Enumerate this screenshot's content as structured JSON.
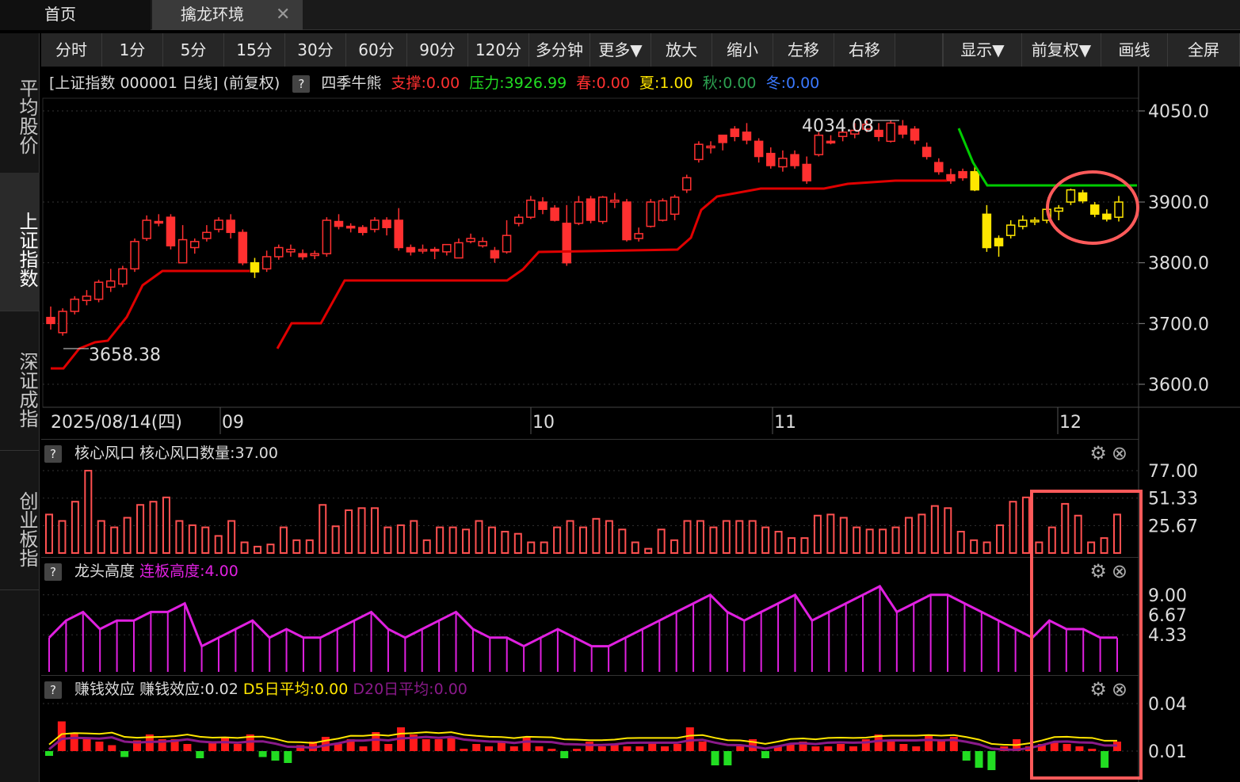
{
  "tabs": {
    "home": "首页",
    "active": "擒龙环境",
    "close_glyph": "✕"
  },
  "leftnav": [
    {
      "label": "平均股价",
      "active": false
    },
    {
      "label": "上证指数",
      "active": true
    },
    {
      "label": "深证成指",
      "active": false
    },
    {
      "label": "创业板指",
      "active": false
    }
  ],
  "toolbar": {
    "periods": [
      "分时",
      "1分",
      "5分",
      "15分",
      "30分",
      "60分",
      "90分",
      "120分",
      "多分钟",
      "更多▼"
    ],
    "actions": [
      "放大",
      "缩小",
      "左移",
      "右移"
    ],
    "right": [
      "显示▼",
      "前复权▼",
      "画线",
      "全屏"
    ]
  },
  "main_header": {
    "title": "[上证指数 000001 日线]",
    "adjust": "(前复权)",
    "help": "?",
    "indicator": "四季牛熊",
    "support": "支撑:0.00",
    "pressure": "压力:3926.99",
    "spring": "春:0.00",
    "summer": "夏:1.00",
    "autumn": "秋:0.00",
    "winter": "冬:0.00"
  },
  "colors": {
    "up": "#ff3030",
    "down": "#ff3030",
    "yellow": "#ffe600",
    "support_line": "#e00000",
    "pressure_line": "#00cc00",
    "magenta": "#e020e0",
    "green_bar": "#22dd22",
    "highlight": "#ff5a5a",
    "spring_color": "#ff3030",
    "summer_color": "#ffe600",
    "autumn_color": "#2ca050",
    "winter_color": "#3a78ff"
  },
  "price_axis": [
    "4050.0",
    "3900.0",
    "3800.0",
    "3700.0",
    "3600.0"
  ],
  "date_axis": {
    "first": "2025/08/14(四)",
    "months": [
      "09",
      "10",
      "11",
      "12"
    ]
  },
  "annotations": {
    "high": "4034.08",
    "low": "3658.38"
  },
  "panels": [
    {
      "name": "核心风口",
      "value": "核心风口数量:37.00",
      "axis": [
        "77.00",
        "51.33",
        "25.67"
      ]
    },
    {
      "name": "龙头高度",
      "value": "连板高度:4.00",
      "axis": [
        "9.00",
        "6.67",
        "4.33"
      ]
    },
    {
      "name": "赚钱效应",
      "value": "赚钱效应:0.02",
      "d5": "D5日平均:0.00",
      "d20": "D20日平均:0.00",
      "axis": [
        "0.04",
        "0.01"
      ]
    }
  ],
  "chart_data": {
    "type": "candlestick",
    "candles": [
      [
        3710,
        3700,
        3728,
        3690,
        "r"
      ],
      [
        3685,
        3720,
        3725,
        3680,
        "r"
      ],
      [
        3720,
        3740,
        3745,
        3715,
        "r"
      ],
      [
        3738,
        3745,
        3755,
        3730,
        "r"
      ],
      [
        3740,
        3768,
        3772,
        3735,
        "r"
      ],
      [
        3760,
        3770,
        3790,
        3752,
        "r"
      ],
      [
        3765,
        3790,
        3795,
        3760,
        "r"
      ],
      [
        3790,
        3835,
        3840,
        3785,
        "r"
      ],
      [
        3840,
        3870,
        3878,
        3836,
        "r"
      ],
      [
        3868,
        3868,
        3880,
        3860,
        "r"
      ],
      [
        3875,
        3828,
        3880,
        3822,
        "r"
      ],
      [
        3800,
        3838,
        3862,
        3800,
        "r"
      ],
      [
        3825,
        3835,
        3840,
        3815,
        "r"
      ],
      [
        3840,
        3850,
        3862,
        3835,
        "r"
      ],
      [
        3855,
        3870,
        3875,
        3850,
        "r"
      ],
      [
        3870,
        3850,
        3880,
        3840,
        "r"
      ],
      [
        3850,
        3800,
        3855,
        3796,
        "r"
      ],
      [
        3800,
        3785,
        3808,
        3775,
        "y"
      ],
      [
        3790,
        3810,
        3820,
        3785,
        "r"
      ],
      [
        3810,
        3825,
        3830,
        3805,
        "r"
      ],
      [
        3818,
        3822,
        3830,
        3810,
        "r"
      ],
      [
        3815,
        3810,
        3822,
        3805,
        "r"
      ],
      [
        3812,
        3815,
        3820,
        3806,
        "r"
      ],
      [
        3815,
        3870,
        3875,
        3810,
        "r"
      ],
      [
        3868,
        3860,
        3880,
        3855,
        "r"
      ],
      [
        3860,
        3858,
        3865,
        3850,
        "r"
      ],
      [
        3858,
        3850,
        3862,
        3845,
        "r"
      ],
      [
        3855,
        3870,
        3875,
        3850,
        "r"
      ],
      [
        3870,
        3858,
        3875,
        3845,
        "r"
      ],
      [
        3870,
        3825,
        3890,
        3820,
        "r"
      ],
      [
        3825,
        3818,
        3830,
        3812,
        "r"
      ],
      [
        3820,
        3822,
        3830,
        3815,
        "r"
      ],
      [
        3822,
        3820,
        3826,
        3806,
        "r"
      ],
      [
        3818,
        3830,
        3830,
        3812,
        "r"
      ],
      [
        3808,
        3833,
        3840,
        3808,
        "r"
      ],
      [
        3835,
        3840,
        3848,
        3832,
        "r"
      ],
      [
        3828,
        3835,
        3842,
        3825,
        "r"
      ],
      [
        3820,
        3808,
        3826,
        3800,
        "r"
      ],
      [
        3818,
        3845,
        3870,
        3815,
        "r"
      ],
      [
        3865,
        3875,
        3880,
        3860,
        "r"
      ],
      [
        3875,
        3903,
        3910,
        3872,
        "r"
      ],
      [
        3900,
        3888,
        3908,
        3880,
        "r"
      ],
      [
        3890,
        3870,
        3895,
        3868,
        "r"
      ],
      [
        3865,
        3800,
        3895,
        3795,
        "r"
      ],
      [
        3865,
        3900,
        3910,
        3862,
        "r"
      ],
      [
        3905,
        3870,
        3910,
        3865,
        "r"
      ],
      [
        3868,
        3908,
        3910,
        3864,
        "r"
      ],
      [
        3900,
        3903,
        3915,
        3890,
        "r"
      ],
      [
        3900,
        3838,
        3905,
        3835,
        "r"
      ],
      [
        3840,
        3848,
        3858,
        3835,
        "r"
      ],
      [
        3860,
        3900,
        3905,
        3858,
        "r"
      ],
      [
        3870,
        3902,
        3906,
        3868,
        "r"
      ],
      [
        3880,
        3908,
        3912,
        3870,
        "r"
      ],
      [
        3920,
        3940,
        3945,
        3915,
        "r"
      ],
      [
        3970,
        3995,
        4000,
        3965,
        "r"
      ],
      [
        3990,
        3992,
        4000,
        3980,
        "r"
      ],
      [
        4010,
        3998,
        4010,
        3985,
        "r"
      ],
      [
        4020,
        4008,
        4025,
        4000,
        "r"
      ],
      [
        4015,
        4002,
        4030,
        3995,
        "r"
      ],
      [
        4000,
        3975,
        4005,
        3965,
        "r"
      ],
      [
        3980,
        3960,
        3990,
        3955,
        "r"
      ],
      [
        3958,
        3972,
        3985,
        3950,
        "r"
      ],
      [
        3978,
        3960,
        3985,
        3955,
        "r"
      ],
      [
        3962,
        3935,
        3975,
        3930,
        "r"
      ],
      [
        3978,
        4010,
        4015,
        3975,
        "r"
      ],
      [
        4000,
        4000,
        4010,
        3995,
        "r"
      ],
      [
        4008,
        4015,
        4025,
        4000,
        "r"
      ],
      [
        4012,
        4018,
        4030,
        4005,
        "r"
      ],
      [
        4020,
        4028,
        4034,
        4015,
        "r"
      ],
      [
        4018,
        4008,
        4030,
        4000,
        "r"
      ],
      [
        4000,
        4030,
        4034,
        3998,
        "r"
      ],
      [
        4025,
        4012,
        4035,
        4005,
        "r"
      ],
      [
        4020,
        4002,
        4025,
        3995,
        "r"
      ],
      [
        3990,
        3975,
        3998,
        3970,
        "r"
      ],
      [
        3965,
        3950,
        3972,
        3945,
        "r"
      ],
      [
        3945,
        3935,
        3955,
        3930,
        "r"
      ],
      [
        3950,
        3940,
        3955,
        3935,
        "r"
      ],
      [
        3950,
        3920,
        3958,
        3918,
        "y"
      ],
      [
        3880,
        3825,
        3895,
        3818,
        "y"
      ],
      [
        3840,
        3828,
        3845,
        3810,
        "y"
      ],
      [
        3845,
        3862,
        3870,
        3840,
        "y"
      ],
      [
        3860,
        3870,
        3878,
        3855,
        "y"
      ],
      [
        3868,
        3870,
        3875,
        3862,
        "y"
      ],
      [
        3870,
        3888,
        3895,
        3865,
        "y"
      ],
      [
        3885,
        3890,
        3895,
        3870,
        "y"
      ],
      [
        3900,
        3920,
        3922,
        3895,
        "y"
      ],
      [
        3915,
        3902,
        3920,
        3898,
        "y"
      ],
      [
        3895,
        3880,
        3900,
        3875,
        "y"
      ],
      [
        3880,
        3872,
        3888,
        3868,
        "y"
      ],
      [
        3875,
        3900,
        3910,
        3868,
        "y"
      ]
    ],
    "panel1_values": [
      36,
      30,
      48,
      77,
      30,
      24,
      33,
      45,
      48,
      52,
      30,
      26,
      24,
      16,
      30,
      10,
      6,
      8,
      24,
      12,
      12,
      45,
      25,
      40,
      42,
      42,
      24,
      26,
      30,
      12,
      24,
      24,
      22,
      30,
      24,
      20,
      18,
      10,
      10,
      24,
      30,
      24,
      32,
      30,
      22,
      10,
      4,
      22,
      12,
      30,
      30,
      24,
      30,
      30,
      30,
      24,
      20,
      14,
      14,
      35,
      36,
      33,
      24,
      22,
      22,
      24,
      33,
      36,
      44,
      42,
      20,
      12,
      10,
      26,
      48,
      52,
      10,
      24,
      46,
      35,
      10,
      14,
      36
    ],
    "panel2_values": [
      4,
      6,
      7,
      5,
      6,
      6,
      7,
      7,
      8,
      3,
      4,
      5,
      6,
      4,
      5,
      4,
      4,
      5,
      6,
      7,
      5,
      4,
      5,
      6,
      7,
      5,
      4,
      4,
      3,
      4,
      5,
      4,
      3,
      3,
      4,
      5,
      6,
      7,
      8,
      9,
      7,
      6,
      7,
      8,
      9,
      6,
      7,
      8,
      9,
      10,
      7,
      8,
      9,
      9,
      8,
      7,
      6,
      5,
      4,
      6,
      5,
      5,
      4,
      4
    ],
    "panel3_values": [
      -0.004,
      0.025,
      0.015,
      0.01,
      0.008,
      0.005,
      -0.005,
      0.009,
      0.014,
      0.01,
      0.01,
      0.006,
      -0.006,
      0.008,
      0.012,
      0.006,
      0.014,
      -0.005,
      -0.008,
      -0.01,
      0.005,
      0.008,
      0.012,
      0.006,
      0.01,
      0.004,
      0.016,
      0.006,
      0.02,
      0.014,
      0.01,
      0.01,
      0.012,
      0.002,
      0.006,
      0.004,
      0.008,
      0.004,
      0.012,
      0.004,
      0.002,
      -0.006,
      0.002,
      0.008,
      0.004,
      0.006,
      0.004,
      0.004,
      0.008,
      0.004,
      0.006,
      0.02,
      0.008,
      -0.012,
      -0.012,
      0.004,
      0.01,
      -0.006,
      0.004,
      0.006,
      0.008,
      0.004,
      0.004,
      0.006,
      0.004,
      0.01,
      0.014,
      0.008,
      0.006,
      0.004,
      0.014,
      0.01,
      0.012,
      -0.008,
      -0.014,
      -0.016,
      0.004,
      0.01,
      0.004,
      0.006,
      0.008,
      0.006,
      0.004,
      0.002,
      -0.014,
      0.008
    ]
  }
}
